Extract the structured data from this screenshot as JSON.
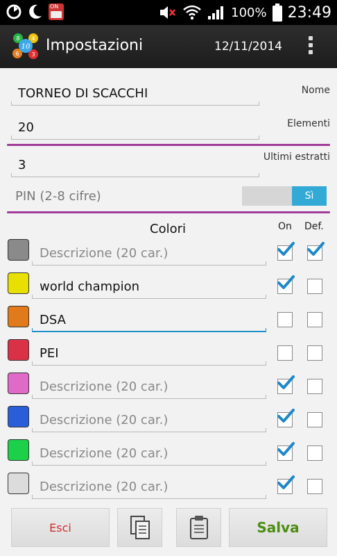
{
  "status_bar": {
    "battery": "100%",
    "time": "23:49",
    "on_badge": "ON"
  },
  "header": {
    "title": "Impostazioni",
    "date": "12/11/2014",
    "icon_numbers": [
      "8",
      "4",
      "10",
      "6",
      "3"
    ]
  },
  "fields": {
    "nome": {
      "value": "TORNEO DI SCACCHI",
      "label": "Nome"
    },
    "elementi": {
      "value": "20",
      "label": "Elementi"
    },
    "ultimi": {
      "value": "3",
      "label": "Ultimi estratti"
    },
    "pin": {
      "placeholder": "PIN (2-8 cifre)",
      "toggle_label": "Sì",
      "enabled": true
    }
  },
  "colors_section": {
    "title": "Colori",
    "col_on": "On",
    "col_def": "Def.",
    "rows": [
      {
        "color": "#8a8a8a",
        "text": "Descrizione (20 car.)",
        "placeholder": true,
        "on": true,
        "def": true
      },
      {
        "color": "#e8e000",
        "text": "world champion",
        "placeholder": false,
        "on": true,
        "def": false
      },
      {
        "color": "#e07a1a",
        "text": "DSA",
        "placeholder": false,
        "on": false,
        "def": false,
        "focused": true
      },
      {
        "color": "#d93246",
        "text": "PEI",
        "placeholder": false,
        "on": false,
        "def": false
      },
      {
        "color": "#e06ac8",
        "text": "Descrizione (20 car.)",
        "placeholder": true,
        "on": true,
        "def": false
      },
      {
        "color": "#2a5ed8",
        "text": "Descrizione (20 car.)",
        "placeholder": true,
        "on": true,
        "def": false
      },
      {
        "color": "#1cd04a",
        "text": "Descrizione (20 car.)",
        "placeholder": true,
        "on": true,
        "def": false
      },
      {
        "color": "#dcdcdc",
        "text": "Descrizione (20 car.)",
        "placeholder": true,
        "on": true,
        "def": false
      }
    ]
  },
  "buttons": {
    "exit": "Esci",
    "save": "Salva",
    "copy_icon": "copy-icon",
    "paste_icon": "clipboard-icon"
  },
  "accent": {
    "separator": "#a03c9a",
    "toggle_on": "#33a9d6",
    "exit": "#d12b2b",
    "save": "#4c8d12"
  }
}
